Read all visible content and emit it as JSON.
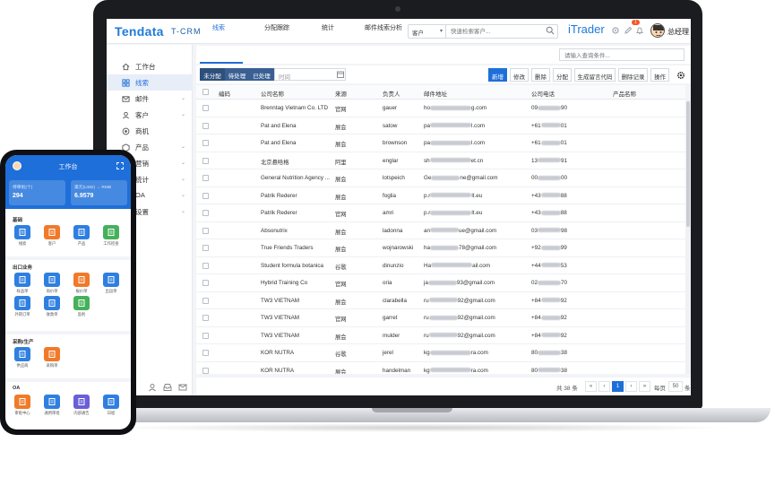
{
  "header": {
    "logo": "Tendata",
    "logo_sub": "T-CRM",
    "search_scope": "客户",
    "search_placeholder": "快速检索客户...",
    "brand": "iTrader",
    "notification_count": "1",
    "user_name": "总经理"
  },
  "sidebar": {
    "items": [
      {
        "label": "工作台",
        "icon": "home-icon"
      },
      {
        "label": "线索",
        "icon": "grid-icon"
      },
      {
        "label": "邮件",
        "icon": "mail-icon"
      },
      {
        "label": "客户",
        "icon": "user-icon"
      },
      {
        "label": "商机",
        "icon": "target-icon"
      },
      {
        "label": "产品",
        "icon": "box-icon"
      },
      {
        "label": "营销",
        "icon": "megaphone-icon"
      },
      {
        "label": "统计",
        "icon": "chart-icon"
      },
      {
        "label": "OA",
        "icon": "briefcase-icon"
      },
      {
        "label": "设置",
        "icon": "gear-icon"
      }
    ]
  },
  "tabs": [
    "线索",
    "分配跟踪",
    "统计",
    "邮件线索分析"
  ],
  "tab_search_placeholder": "请输入查询条件...",
  "toolbar": {
    "segments": [
      "未分配",
      "待处理",
      "已处理"
    ],
    "time_placeholder": "时间",
    "buttons": [
      "新增",
      "修改",
      "删除",
      "分配",
      "生成留言代码",
      "删除记录",
      "操作"
    ]
  },
  "table": {
    "columns": [
      "编码",
      "公司名称",
      "来源",
      "负责人",
      "邮件地址",
      "公司电话",
      "产品名称"
    ],
    "rows": [
      {
        "company": "Brenntag Vietnam Co. LTD",
        "source": "官网",
        "owner": "gauer",
        "email_start": "ho",
        "email_end": "g.com",
        "phone_start": "09",
        "phone_end": "90"
      },
      {
        "company": "Pat and Elena",
        "source": "展会",
        "owner": "satow",
        "email_start": "pa",
        "email_end": "l.com",
        "phone_start": "+61",
        "phone_end": "01"
      },
      {
        "company": "Pat and Elena",
        "source": "展会",
        "owner": "brownson",
        "email_start": "pa",
        "email_end": "l.com",
        "phone_start": "+61",
        "phone_end": "01"
      },
      {
        "company": "北京悬哈格",
        "source": "阿里",
        "owner": "englar",
        "email_start": "sh",
        "email_end": "et.cn",
        "phone_start": "13",
        "phone_end": "91"
      },
      {
        "company": "General Nutrition Agency ...",
        "source": "展会",
        "owner": "lotspeich",
        "email_start": "Ge",
        "email_end": "ne@gmail.com",
        "phone_start": "00",
        "phone_end": "00"
      },
      {
        "company": "Patrik Rederer",
        "source": "展会",
        "owner": "foglia",
        "email_start": "p.r",
        "email_end": "lt.eu",
        "phone_start": "+43",
        "phone_end": "88"
      },
      {
        "company": "Patrik Rederer",
        "source": "官网",
        "owner": "amri",
        "email_start": "p.r",
        "email_end": "lt.eu",
        "phone_start": "+43",
        "phone_end": "88"
      },
      {
        "company": "Absonutrix",
        "source": "展会",
        "owner": "ladonna",
        "email_start": "an",
        "email_end": "ue@gmail.com",
        "phone_start": "03",
        "phone_end": "98"
      },
      {
        "company": "True Friends Traders",
        "source": "展会",
        "owner": "wojnarowski",
        "email_start": "ha",
        "email_end": "78@gmail.com",
        "phone_start": "+92",
        "phone_end": "99"
      },
      {
        "company": "Student formula botanica",
        "source": "谷歌",
        "owner": "dinunzio",
        "email_start": "Ha",
        "email_end": "ail.com",
        "phone_start": "+44",
        "phone_end": "53"
      },
      {
        "company": "Hybrid Training Co",
        "source": "官网",
        "owner": "oria",
        "email_start": "ja",
        "email_end": "93@gmail.com",
        "phone_start": "02",
        "phone_end": "70"
      },
      {
        "company": "TW3 VIETNAM",
        "source": "展会",
        "owner": "clarabella",
        "email_start": "ru",
        "email_end": "92@gmail.com",
        "phone_start": "+84",
        "phone_end": "92"
      },
      {
        "company": "TW3 VIETNAM",
        "source": "官网",
        "owner": "garret",
        "email_start": "ru",
        "email_end": "92@gmail.com",
        "phone_start": "+84",
        "phone_end": "92"
      },
      {
        "company": "TW3 VIETNAM",
        "source": "展会",
        "owner": "mulder",
        "email_start": "ru",
        "email_end": "92@gmail.com",
        "phone_start": "+84",
        "phone_end": "92"
      },
      {
        "company": "KOR NUTRA",
        "source": "谷歌",
        "owner": "jerel",
        "email_start": "kg",
        "email_end": "ra.com",
        "phone_start": "80",
        "phone_end": "38"
      },
      {
        "company": "KOR NUTRA",
        "source": "展会",
        "owner": "handelman",
        "email_start": "kg",
        "email_end": "ra.com",
        "phone_start": "80",
        "phone_end": "38"
      }
    ]
  },
  "pagination": {
    "total": "共 38 条",
    "current": "1",
    "per_label": "每页",
    "size": "50",
    "unit": "条"
  },
  "phone": {
    "title": "工作台",
    "card1_label": "待审批(个)",
    "card1_value": "294",
    "card2_label": "美元(USD) → RMB",
    "card2_value": "6.9579",
    "sections": [
      "基础",
      "出口业务",
      "采购/生产",
      "OA"
    ],
    "apps_basic": [
      "线索",
      "客户",
      "产品",
      "工作检查"
    ],
    "apps_export": [
      "样品单",
      "询价单",
      "报价单",
      "出运单",
      "外销订单",
      "收款单",
      "盈利"
    ],
    "apps_purchase": [
      "供应商",
      "采购单"
    ],
    "apps_oa": [
      "审批中心",
      "通用审批",
      "内部通告",
      "日程"
    ]
  }
}
